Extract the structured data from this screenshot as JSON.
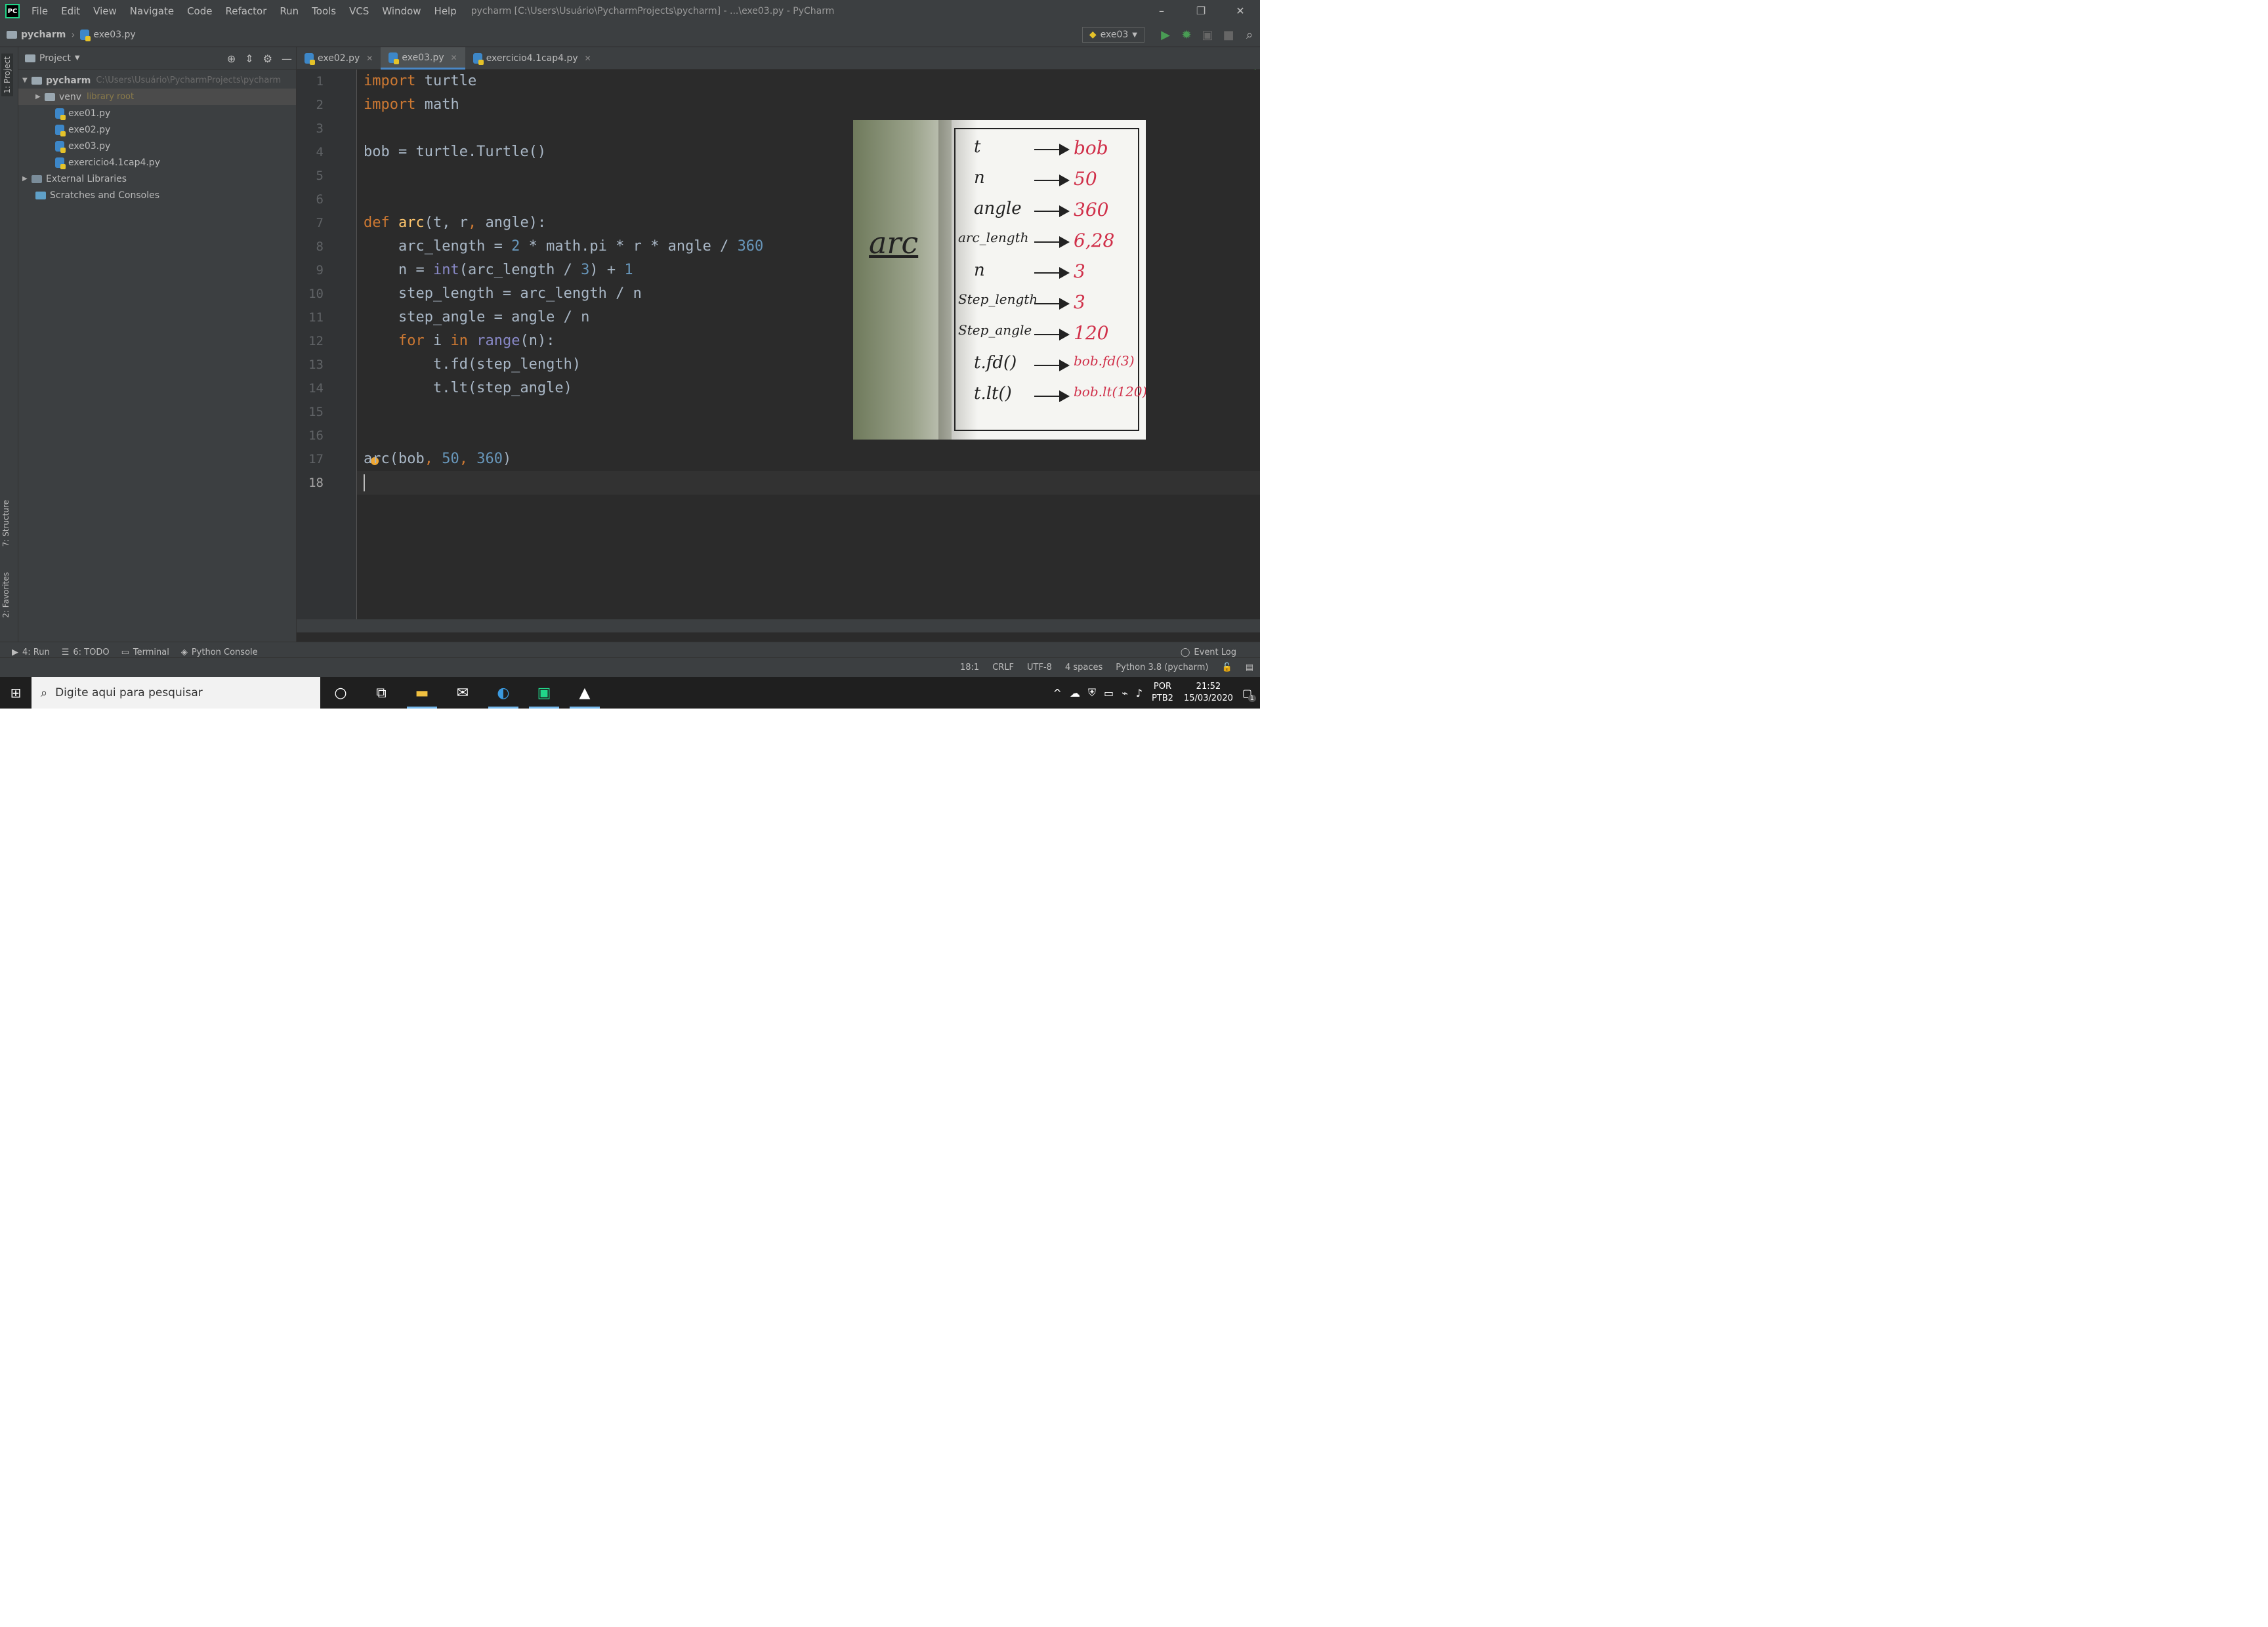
{
  "window": {
    "title": "pycharm [C:\\Users\\Usuário\\PycharmProjects\\pycharm] - ...\\exe03.py - PyCharm",
    "controls": [
      "–",
      "❐",
      "✕"
    ]
  },
  "menu": [
    "File",
    "Edit",
    "View",
    "Navigate",
    "Code",
    "Refactor",
    "Run",
    "Tools",
    "VCS",
    "Window",
    "Help"
  ],
  "breadcrumb": {
    "project": "pycharm",
    "file": "exe03.py"
  },
  "run_config": {
    "label": "exe03"
  },
  "left_stripe": {
    "project": "1: Project",
    "structure": "7: Structure",
    "favorites": "2: Favorites"
  },
  "project_panel": {
    "header": "Project",
    "root_name": "pycharm",
    "root_path": "C:\\Users\\Usuário\\PycharmProjects\\pycharm",
    "venv": "venv",
    "venv_note": "library root",
    "files": [
      "exe01.py",
      "exe02.py",
      "exe03.py",
      "exercicio4.1cap4.py"
    ],
    "external": "External Libraries",
    "scratches": "Scratches and Consoles"
  },
  "tabs": [
    "exe02.py",
    "exe03.py",
    "exercicio4.1cap4.py"
  ],
  "active_tab": 1,
  "code_lines": [
    [
      [
        "kw",
        "import"
      ],
      [
        "tx",
        " turtle"
      ]
    ],
    [
      [
        "kw",
        "import"
      ],
      [
        "tx",
        " math"
      ]
    ],
    [],
    [
      [
        "tx",
        "bob = turtle.Turtle()"
      ]
    ],
    [],
    [],
    [
      [
        "kw",
        "def "
      ],
      [
        "fn",
        "arc"
      ],
      [
        "tx",
        "(t, "
      ],
      [
        "tx",
        "r"
      ],
      [
        "kw",
        ", "
      ],
      [
        "tx",
        "angle):"
      ]
    ],
    [
      [
        "tx",
        "    arc_length = "
      ],
      [
        "num",
        "2"
      ],
      [
        "tx",
        " * math.pi * r * angle / "
      ],
      [
        "num",
        "360"
      ]
    ],
    [
      [
        "tx",
        "    n = "
      ],
      [
        "bi",
        "int"
      ],
      [
        "tx",
        "(arc_length / "
      ],
      [
        "num",
        "3"
      ],
      [
        "tx",
        ") + "
      ],
      [
        "num",
        "1"
      ]
    ],
    [
      [
        "tx",
        "    step_length = arc_length / n"
      ]
    ],
    [
      [
        "tx",
        "    step_angle = angle / n"
      ]
    ],
    [
      [
        "kw",
        "    for"
      ],
      [
        "tx",
        " i "
      ],
      [
        "kw",
        "in"
      ],
      [
        "tx",
        " "
      ],
      [
        "bi",
        "range"
      ],
      [
        "tx",
        "(n):"
      ]
    ],
    [
      [
        "tx",
        "        t.fd(step_length)"
      ]
    ],
    [
      [
        "tx",
        "        t.lt(step_angle)"
      ]
    ],
    [],
    [],
    [
      [
        "tx",
        "arc(bob"
      ],
      [
        "kw",
        ", "
      ],
      [
        "num",
        "50"
      ],
      [
        "kw",
        ", "
      ],
      [
        "num",
        "360"
      ],
      [
        "tx",
        ")"
      ]
    ],
    []
  ],
  "current_line": 18,
  "photo": {
    "title": "arc",
    "rows": [
      {
        "left": "t",
        "right": "bob"
      },
      {
        "left": "n",
        "right": "50"
      },
      {
        "left": "angle",
        "right": "360"
      },
      {
        "left": "arc_length",
        "right": "6,28"
      },
      {
        "left": "n",
        "right": "3"
      },
      {
        "left": "Step_length",
        "right": "3"
      },
      {
        "left": "Step_angle",
        "right": "120"
      },
      {
        "left": "t.fd()",
        "right": "bob.fd(3)"
      },
      {
        "left": "t.lt()",
        "right": "bob.lt(120)"
      }
    ]
  },
  "tool_windows": [
    "4: Run",
    "6: TODO",
    "Terminal",
    "Python Console"
  ],
  "event_log": "Event Log",
  "status": {
    "position": "18:1",
    "line_sep": "CRLF",
    "encoding": "UTF-8",
    "indent": "4 spaces",
    "interpreter": "Python 3.8 (pycharm)"
  },
  "taskbar": {
    "search_placeholder": "Digite aqui para pesquisar",
    "lang": "POR",
    "layout": "PTB2",
    "time": "21:52",
    "date": "15/03/2020",
    "notif_count": "1"
  },
  "colors": {
    "accent": "#4a88c7",
    "keyword": "#cc7832",
    "function": "#ffc66d",
    "number": "#6897bb",
    "builtin": "#8888c6"
  }
}
